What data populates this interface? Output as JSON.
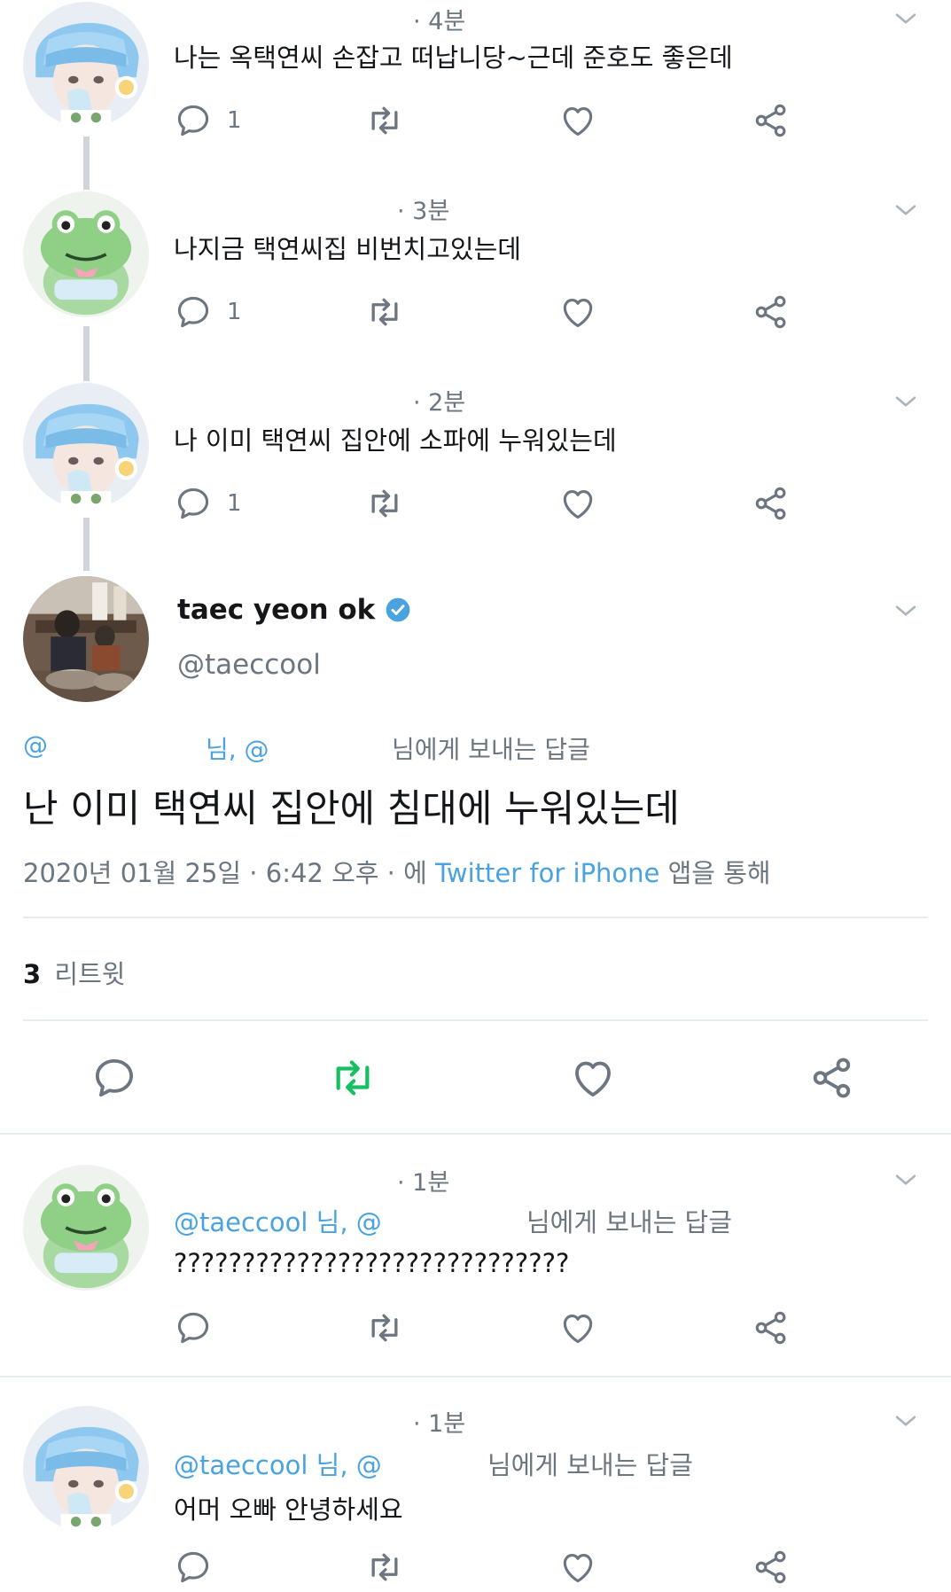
{
  "replies_top": [
    {
      "time": "· 4분",
      "text": "나는 옥택연씨 손잡고 떠납니당~근데 준호도 좋은데",
      "reply_count": "1"
    },
    {
      "time": "· 3분",
      "text": "나지금 택연씨집 비번치고있는데",
      "reply_count": "1"
    },
    {
      "time": "· 2분",
      "text": "나 이미 택연씨 집안에 소파에 누워있는데",
      "reply_count": "1"
    }
  ],
  "main_tweet": {
    "display_name": "taec yeon ok",
    "handle": "@taeccool",
    "reply_to_prefix": "@",
    "reply_to_mid": "님, @",
    "reply_to_suffix": "님에게 보내는 답글",
    "text": "난 이미 택연씨 집안에 침대에 누워있는데",
    "timestamp": "2020년 01월 25일 · 6:42 오후 · 에 ",
    "client": "Twitter for iPhone",
    "client_suffix": " 앱을 통해",
    "retweet_count": "3",
    "retweet_label": "리트윗"
  },
  "replies_bottom": [
    {
      "time": "· 1분",
      "mention": "@taeccool 님, @",
      "suffix": "님에게 보내는 답글",
      "text": "?????????????????????????????"
    },
    {
      "time": "· 1분",
      "mention": "@taeccool 님, @",
      "suffix": "님에게 보내는 답글",
      "text": "어머 오빠 안녕하세요"
    }
  ],
  "colors": {
    "accent": "#4aa3df",
    "retweet_active": "#17bf63",
    "icon_grey": "#6b7680"
  }
}
